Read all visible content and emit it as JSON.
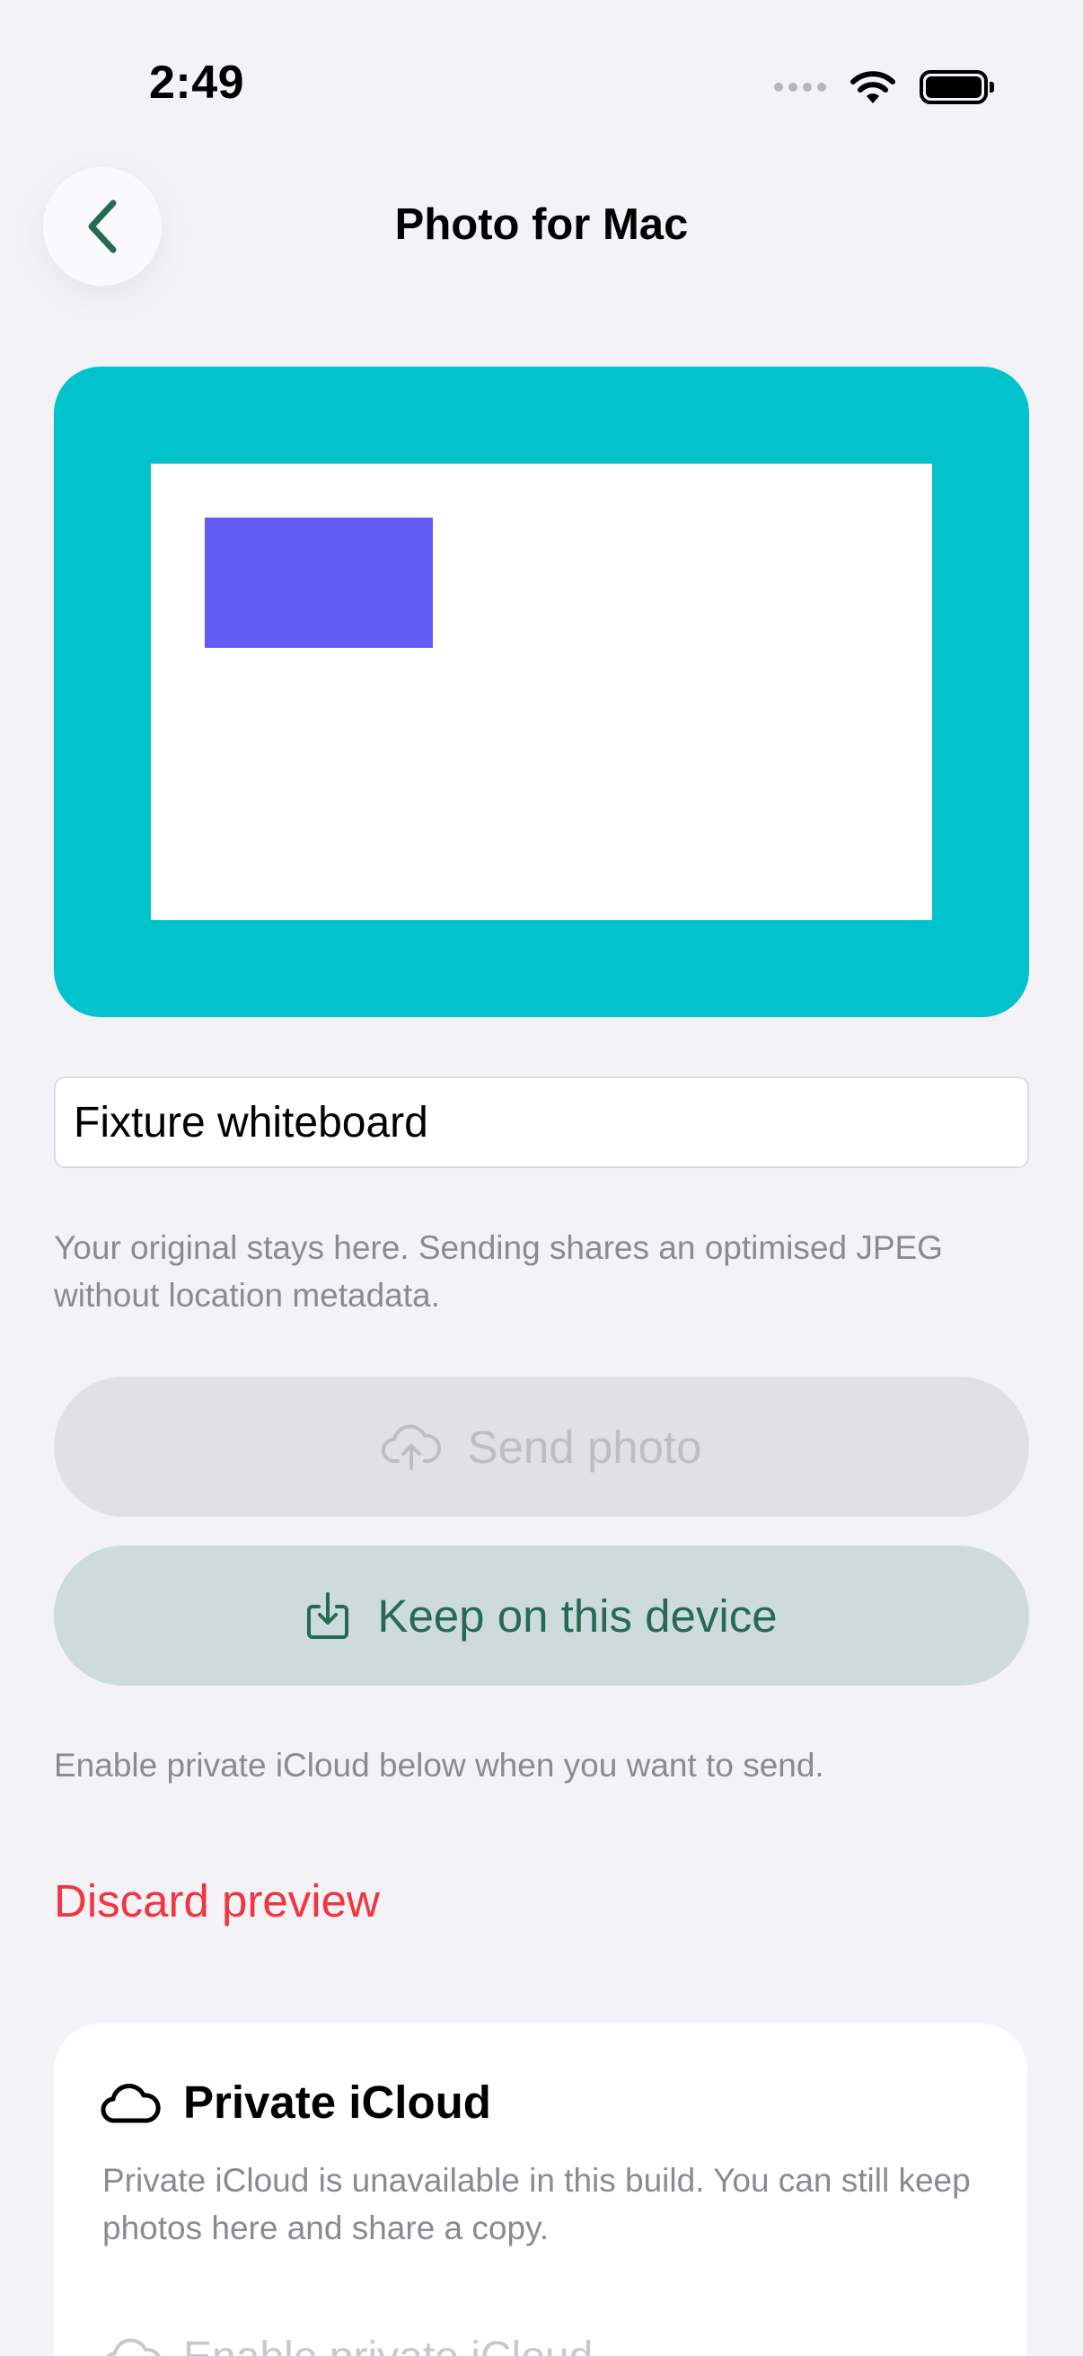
{
  "status_bar": {
    "time": "2:49"
  },
  "nav": {
    "title": "Photo for Mac"
  },
  "preview": {
    "frame_color": "#02c3cc",
    "inner_color": "#ffffff",
    "shape_color": "#635bf6"
  },
  "form": {
    "title_value": "Fixture whiteboard",
    "note": "Your original stays here. Sending shares an optimised JPEG without location metadata."
  },
  "actions": {
    "send_label": "Send photo",
    "send_icon": "cloud-upload-icon",
    "keep_label": "Keep on this device",
    "keep_icon": "download-tray-icon",
    "hint": "Enable private iCloud below when you want to send.",
    "discard_label": "Discard preview"
  },
  "icloud_card": {
    "title": "Private iCloud",
    "description": "Private iCloud is unavailable in this build. You can still keep photos here and share a copy.",
    "toggle_label": "Enable private iCloud"
  },
  "colors": {
    "accent_green": "#276a54",
    "destructive": "#f2353e",
    "background": "#f2f2f7"
  }
}
